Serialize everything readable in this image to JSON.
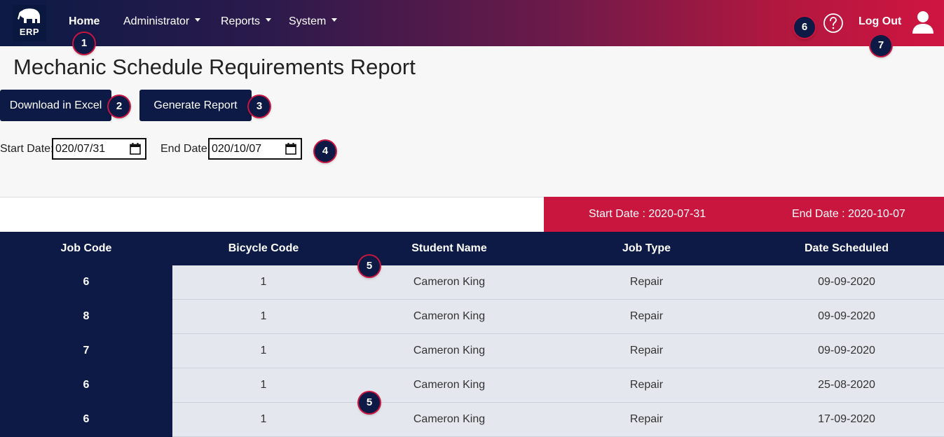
{
  "nav": {
    "logo_text": "ERP",
    "home": "Home",
    "administrator": "Administrator",
    "reports": "Reports",
    "system": "System",
    "logout": "Log Out"
  },
  "badges": {
    "b1": "1",
    "b2": "2",
    "b3": "3",
    "b4": "4",
    "b5a": "5",
    "b5b": "5",
    "b6": "6",
    "b7": "7"
  },
  "page": {
    "title": "Mechanic Schedule Requirements Report"
  },
  "actions": {
    "download_label": "Download in Excel",
    "generate_label": "Generate Report"
  },
  "filters": {
    "start_label": "Start Date:",
    "start_value": "020/07/31",
    "end_label": "End Date:",
    "end_value": "020/10/07"
  },
  "range": {
    "start_text": "Start Date : 2020-07-31",
    "end_text": "End Date : 2020-10-07"
  },
  "table": {
    "headers": [
      "Job Code",
      "Bicycle Code",
      "Student Name",
      "Job Type",
      "Date Scheduled"
    ],
    "rows": [
      [
        "6",
        "1",
        "Cameron King",
        "Repair",
        "09-09-2020"
      ],
      [
        "8",
        "1",
        "Cameron King",
        "Repair",
        "09-09-2020"
      ],
      [
        "7",
        "1",
        "Cameron King",
        "Repair",
        "09-09-2020"
      ],
      [
        "6",
        "1",
        "Cameron King",
        "Repair",
        "25-08-2020"
      ],
      [
        "6",
        "1",
        "Cameron King",
        "Repair",
        "17-09-2020"
      ]
    ]
  },
  "colors": {
    "navy": "#0c1a45",
    "crimson": "#c8163f",
    "row_bg": "#e4e7ee"
  },
  "icons": {
    "logo": "elephant-icon",
    "help": "help-circle-icon",
    "user": "user-icon",
    "calendar": "calendar-icon"
  }
}
